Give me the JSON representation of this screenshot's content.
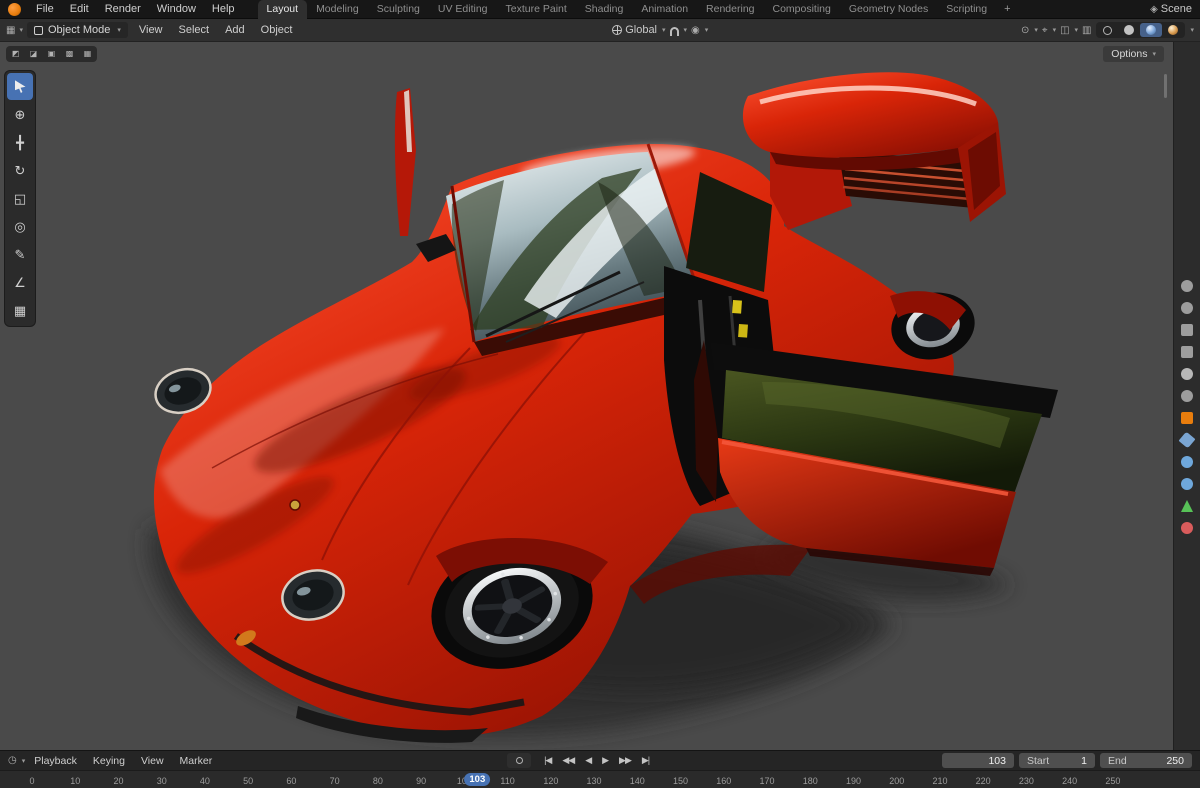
{
  "topbar": {
    "menus": [
      "File",
      "Edit",
      "Render",
      "Window",
      "Help"
    ],
    "tabs": [
      {
        "label": "Layout",
        "active": true
      },
      {
        "label": "Modeling"
      },
      {
        "label": "Sculpting"
      },
      {
        "label": "UV Editing"
      },
      {
        "label": "Texture Paint"
      },
      {
        "label": "Shading"
      },
      {
        "label": "Animation"
      },
      {
        "label": "Rendering"
      },
      {
        "label": "Compositing"
      },
      {
        "label": "Geometry Nodes"
      },
      {
        "label": "Scripting"
      }
    ],
    "add_tab": "+",
    "scene_icon": "◈",
    "scene_label": "Scene"
  },
  "viewport_header": {
    "editor_icon": "▦",
    "mode_label": "Object Mode",
    "menus": [
      "View",
      "Select",
      "Add",
      "Object"
    ],
    "orientation_label": "Global",
    "icons": {
      "visibility": "⊙",
      "gizmo": "⌖",
      "overlays": "◫",
      "xray": "▥",
      "proportional": "◉"
    },
    "corner_toggles": [
      {
        "name": "select-mode-toggle-1",
        "glyph": "◩"
      },
      {
        "name": "select-mode-toggle-2",
        "glyph": "◪"
      },
      {
        "name": "select-mode-toggle-3",
        "glyph": "▣"
      },
      {
        "name": "select-mode-toggle-4",
        "glyph": "▩"
      },
      {
        "name": "select-mode-toggle-5",
        "glyph": "▦"
      }
    ],
    "options_label": "Options"
  },
  "shading_modes": [
    {
      "name": "wireframe"
    },
    {
      "name": "solid"
    },
    {
      "name": "material-preview",
      "active": true
    },
    {
      "name": "rendered"
    }
  ],
  "tools": [
    {
      "name": "tool-select-box",
      "shape": "cursor",
      "active": true
    },
    {
      "name": "tool-cursor",
      "glyph": "⊕"
    },
    {
      "name": "tool-move",
      "glyph": "╋"
    },
    {
      "name": "tool-rotate",
      "glyph": "↻"
    },
    {
      "name": "tool-scale",
      "glyph": "◱"
    },
    {
      "name": "tool-transform",
      "glyph": "◎"
    },
    {
      "name": "tool-annotate",
      "glyph": "✎"
    },
    {
      "name": "tool-measure",
      "glyph": "∠"
    },
    {
      "name": "tool-add-cube",
      "glyph": "▦"
    }
  ],
  "props_rail": [
    {
      "name": "tool-props-tab",
      "shape": "circle",
      "color": "#9d9d9d"
    },
    {
      "name": "render-props-tab",
      "shape": "circle",
      "color": "#9d9d9d"
    },
    {
      "name": "output-props-tab",
      "shape": "square",
      "color": "#9d9d9d"
    },
    {
      "name": "view-layer-props-tab",
      "shape": "square",
      "color": "#9d9d9d"
    },
    {
      "name": "scene-props-tab",
      "shape": "circle",
      "color": "#b8b8b8"
    },
    {
      "name": "world-props-tab",
      "shape": "circle",
      "color": "#9d9d9d"
    },
    {
      "name": "object-props-tab",
      "shape": "square",
      "color": "#e87d0d"
    },
    {
      "name": "modifiers-props-tab",
      "shape": "wrench",
      "color": "#7aa5d2"
    },
    {
      "name": "particles-props-tab",
      "shape": "circle",
      "color": "#6fa8dc"
    },
    {
      "name": "physics-props-tab",
      "shape": "circle",
      "color": "#6fa8dc"
    },
    {
      "name": "object-data-props-tab",
      "shape": "triangle",
      "color": "#57c257"
    },
    {
      "name": "material-props-tab",
      "shape": "circle",
      "color": "#d95c5c"
    }
  ],
  "timeline": {
    "editor_icon": "◷",
    "menus": [
      "Playback",
      "Keying",
      "View",
      "Marker"
    ],
    "transport": [
      {
        "name": "jump-to-start-button",
        "glyph": "|◀"
      },
      {
        "name": "previous-keyframe-button",
        "glyph": "◀◀"
      },
      {
        "name": "play-reverse-button",
        "glyph": "◀"
      },
      {
        "name": "play-button",
        "glyph": "▶"
      },
      {
        "name": "next-keyframe-button",
        "glyph": "▶▶"
      },
      {
        "name": "jump-to-end-button",
        "glyph": "▶|"
      }
    ],
    "current_frame": "103",
    "start_label": "Start",
    "start_value": "1",
    "end_label": "End",
    "end_value": "250"
  },
  "ruler": {
    "ticks": [
      {
        "label": "0",
        "frame": 0
      },
      {
        "label": "10",
        "frame": 10
      },
      {
        "label": "20",
        "frame": 20
      },
      {
        "label": "30",
        "frame": 30
      },
      {
        "label": "40",
        "frame": 40
      },
      {
        "label": "50",
        "frame": 50
      },
      {
        "label": "60",
        "frame": 60
      },
      {
        "label": "70",
        "frame": 70
      },
      {
        "label": "80",
        "frame": 80
      },
      {
        "label": "90",
        "frame": 90
      },
      {
        "label": "100",
        "frame": 100
      },
      {
        "label": "110",
        "frame": 110
      },
      {
        "label": "120",
        "frame": 120
      },
      {
        "label": "130",
        "frame": 130
      },
      {
        "label": "140",
        "frame": 140
      },
      {
        "label": "150",
        "frame": 150
      },
      {
        "label": "160",
        "frame": 160
      },
      {
        "label": "170",
        "frame": 170
      },
      {
        "label": "180",
        "frame": 180
      },
      {
        "label": "190",
        "frame": 190
      },
      {
        "label": "200",
        "frame": 200
      },
      {
        "label": "210",
        "frame": 210
      },
      {
        "label": "220",
        "frame": 220
      },
      {
        "label": "230",
        "frame": 230
      },
      {
        "label": "240",
        "frame": 240
      },
      {
        "label": "250",
        "frame": 250
      }
    ],
    "playhead_frame": 103,
    "playhead_label": "103"
  },
  "colors": {
    "accent": "#4772b3",
    "car_red": "#c91a0a",
    "viewport_bg": "#4a4a4a",
    "object_orange": "#e87d0d"
  }
}
